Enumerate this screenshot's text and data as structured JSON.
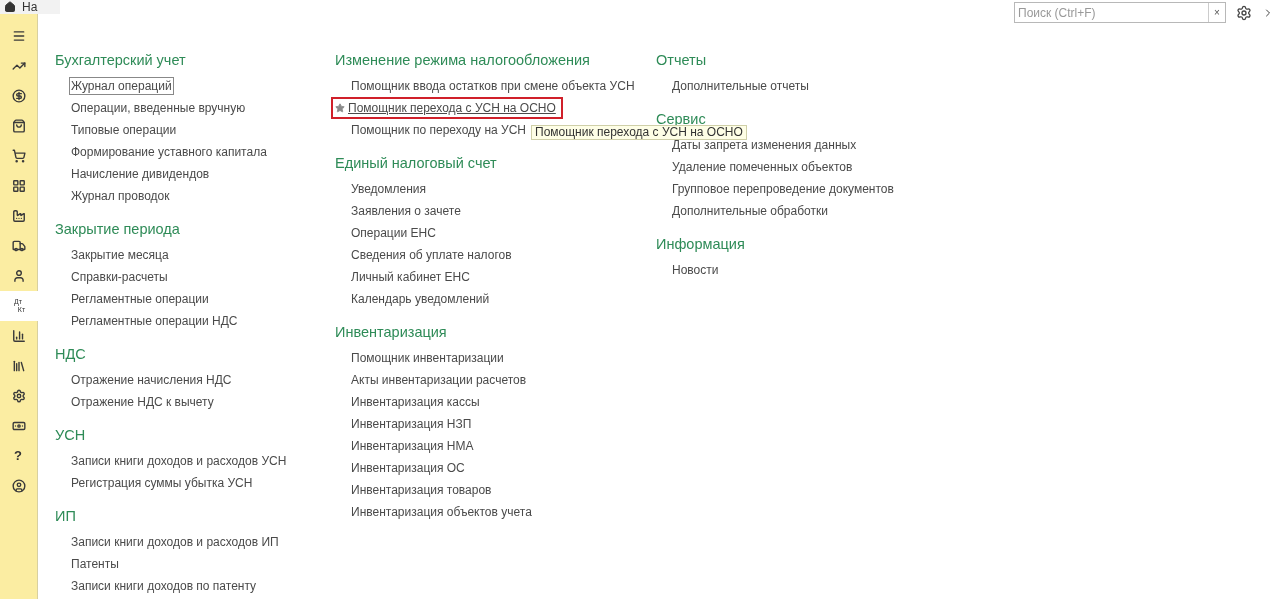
{
  "tab": {
    "label": "На"
  },
  "sidebar": {
    "items": [
      {
        "kind": "icon",
        "selected": false
      },
      {
        "kind": "icon",
        "selected": false
      },
      {
        "kind": "icon",
        "selected": false
      },
      {
        "kind": "icon",
        "selected": false
      },
      {
        "kind": "icon",
        "selected": false
      },
      {
        "kind": "icon",
        "selected": false
      },
      {
        "kind": "icon",
        "selected": false
      },
      {
        "kind": "icon",
        "selected": false
      },
      {
        "kind": "icon",
        "selected": false
      },
      {
        "kind": "text",
        "lines": [
          "Дт",
          "Кт"
        ],
        "selected": true
      },
      {
        "kind": "icon",
        "selected": false
      },
      {
        "kind": "icon",
        "selected": false
      },
      {
        "kind": "icon",
        "selected": false
      },
      {
        "kind": "icon",
        "selected": false
      },
      {
        "kind": "text",
        "lines": [
          "?"
        ],
        "selected": false
      },
      {
        "kind": "icon",
        "selected": false
      }
    ]
  },
  "search": {
    "placeholder": "Поиск (Ctrl+F)",
    "clear": "×"
  },
  "columns": [
    [
      {
        "title": "Бухгалтерский учет",
        "items": [
          {
            "label": "Журнал операций",
            "kind": "focused"
          },
          {
            "label": "Операции, введенные вручную",
            "kind": "plain"
          },
          {
            "label": "Типовые операции",
            "kind": "plain"
          },
          {
            "label": "Формирование уставного капитала",
            "kind": "plain"
          },
          {
            "label": "Начисление дивидендов",
            "kind": "plain"
          },
          {
            "label": "Журнал проводок",
            "kind": "plain"
          }
        ]
      },
      {
        "title": "Закрытие периода",
        "items": [
          {
            "label": "Закрытие месяца",
            "kind": "plain"
          },
          {
            "label": "Справки-расчеты",
            "kind": "plain"
          },
          {
            "label": "Регламентные операции",
            "kind": "plain"
          },
          {
            "label": "Регламентные операции НДС",
            "kind": "plain"
          }
        ]
      },
      {
        "title": "НДС",
        "items": [
          {
            "label": "Отражение начисления НДС",
            "kind": "plain"
          },
          {
            "label": "Отражение НДС к вычету",
            "kind": "plain"
          }
        ]
      },
      {
        "title": "УСН",
        "items": [
          {
            "label": "Записи книги доходов и расходов УСН",
            "kind": "plain"
          },
          {
            "label": "Регистрация суммы убытка УСН",
            "kind": "plain"
          }
        ]
      },
      {
        "title": "ИП",
        "items": [
          {
            "label": "Записи книги доходов и расходов ИП",
            "kind": "plain"
          },
          {
            "label": "Патенты",
            "kind": "plain"
          },
          {
            "label": "Записи книги доходов по патенту",
            "kind": "plain"
          }
        ]
      }
    ],
    [
      {
        "title": "Изменение режима налогообложения",
        "items": [
          {
            "label": "Помощник ввода остатков при смене объекта УСН",
            "kind": "plain"
          },
          {
            "label": "Помощник перехода с УСН на ОСНО",
            "kind": "highlighted"
          },
          {
            "label": "Помощник по переходу на УСН",
            "kind": "plain"
          }
        ]
      },
      {
        "title": "Единый налоговый счет",
        "items": [
          {
            "label": "Уведомления",
            "kind": "plain"
          },
          {
            "label": "Заявления о зачете",
            "kind": "plain"
          },
          {
            "label": "Операции ЕНС",
            "kind": "plain"
          },
          {
            "label": "Сведения об уплате налогов",
            "kind": "plain"
          },
          {
            "label": "Личный кабинет ЕНС",
            "kind": "plain"
          },
          {
            "label": "Календарь уведомлений",
            "kind": "plain"
          }
        ]
      },
      {
        "title": "Инвентаризация",
        "items": [
          {
            "label": "Помощник инвентаризации",
            "kind": "plain"
          },
          {
            "label": "Акты инвентаризации расчетов",
            "kind": "plain"
          },
          {
            "label": "Инвентаризация кассы",
            "kind": "plain"
          },
          {
            "label": "Инвентаризация НЗП",
            "kind": "plain"
          },
          {
            "label": "Инвентаризация НМА",
            "kind": "plain"
          },
          {
            "label": "Инвентаризация ОС",
            "kind": "plain"
          },
          {
            "label": "Инвентаризация товаров",
            "kind": "plain"
          },
          {
            "label": "Инвентаризация объектов учета",
            "kind": "plain"
          }
        ]
      }
    ],
    [
      {
        "title": "Отчеты",
        "items": [
          {
            "label": "Дополнительные отчеты",
            "kind": "plain"
          }
        ]
      },
      {
        "title": "Сервис",
        "items": [
          {
            "label": "Даты запрета изменения данных",
            "kind": "plain"
          },
          {
            "label": "Удаление помеченных объектов",
            "kind": "plain"
          },
          {
            "label": "Групповое перепроведение документов",
            "kind": "plain"
          },
          {
            "label": "Дополнительные обработки",
            "kind": "plain"
          }
        ]
      },
      {
        "title": "Информация",
        "items": [
          {
            "label": "Новости",
            "kind": "plain"
          }
        ]
      }
    ]
  ],
  "tooltip": {
    "text": "Помощник перехода с УСН на ОСНО"
  }
}
